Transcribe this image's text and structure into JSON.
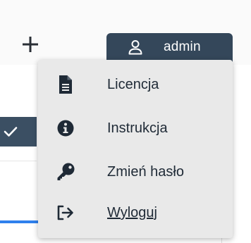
{
  "colors": {
    "header_button": "#34475a",
    "menu_background": "#e9e9e9",
    "menu_text": "#1f2a36",
    "icon": "#1f2a36",
    "accent_blue": "#2f80ed"
  },
  "header": {
    "add_icon": "plus-icon",
    "user_icon": "user-icon",
    "user_label": "admin"
  },
  "menu": {
    "items": [
      {
        "label": "Licencja",
        "icon": "document-icon"
      },
      {
        "label": "Instrukcja",
        "icon": "info-icon"
      },
      {
        "label": "Zmień hasło",
        "icon": "key-icon"
      },
      {
        "label": "Wyloguj",
        "icon": "logout-icon"
      }
    ]
  },
  "background": {
    "check_icon": "check-icon"
  }
}
